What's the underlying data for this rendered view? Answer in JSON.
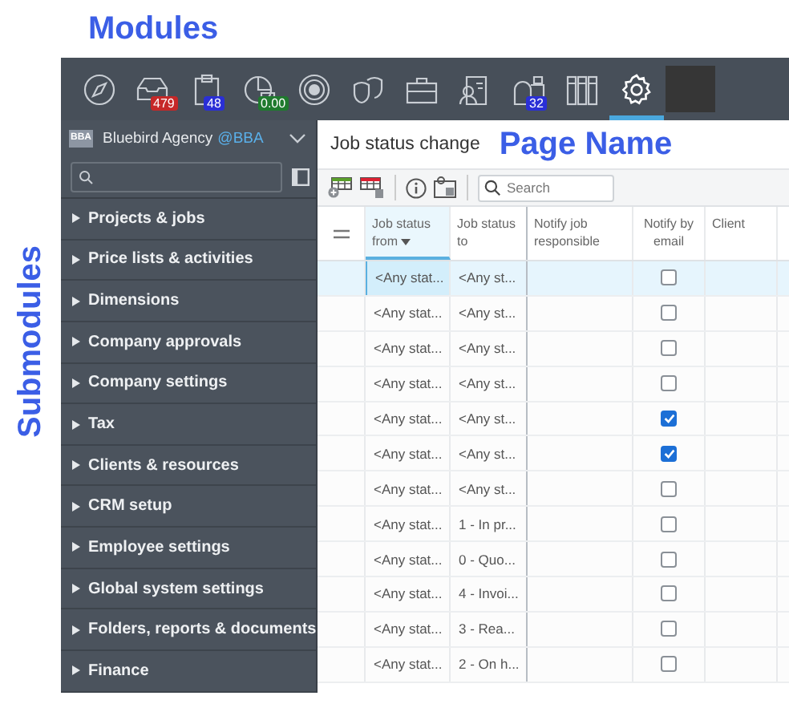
{
  "annotations": {
    "modules": "Modules",
    "page_name": "Page Name",
    "submodules": "Submodules"
  },
  "modules": [
    {
      "selected": false
    },
    {
      "selected": false,
      "badge": {
        "text": "479",
        "color": "#c62828"
      }
    },
    {
      "selected": false,
      "badge": {
        "text": "48",
        "color": "#2a2fd6"
      }
    },
    {
      "selected": false,
      "badge": {
        "text": "0.00",
        "color": "#1f7a2e"
      }
    },
    {
      "selected": false
    },
    {
      "selected": false
    },
    {
      "selected": false
    },
    {
      "selected": false
    },
    {
      "selected": false,
      "badge": {
        "text": "32",
        "color": "#2a2fd6"
      }
    },
    {
      "selected": false
    },
    {
      "selected": true
    }
  ],
  "sidebar": {
    "org_badge": "BBA",
    "org_name": "Bluebird Agency",
    "org_handle": "@BBA",
    "items": [
      {
        "label": "Projects & jobs",
        "expanded": false
      },
      {
        "label": "Price lists & activities",
        "expanded": false
      },
      {
        "label": "Dimensions",
        "expanded": false
      },
      {
        "label": "Company approvals",
        "expanded": false
      },
      {
        "label": "Company settings",
        "expanded": false
      },
      {
        "label": "Tax",
        "expanded": false
      },
      {
        "label": "Clients & resources",
        "expanded": false
      },
      {
        "label": "CRM setup",
        "expanded": false
      },
      {
        "label": "Employee settings",
        "expanded": false
      },
      {
        "label": "Global system settings",
        "expanded": false
      },
      {
        "label": "Folders, reports & documents",
        "expanded": false
      },
      {
        "label": "Finance",
        "expanded": false
      }
    ]
  },
  "page": {
    "title": "Job status change",
    "search": {
      "placeholder": "Search"
    }
  },
  "table": {
    "columns": [
      {
        "label": "Job status from",
        "sorted": true
      },
      {
        "label": "Job status to",
        "sorted": false
      },
      {
        "label": "Notify job responsible",
        "sorted": false
      },
      {
        "label": "Notify by email",
        "sorted": false
      },
      {
        "label": "Client",
        "sorted": false
      }
    ],
    "rows": [
      {
        "from": "<Any stat...",
        "to": "<Any st...",
        "notify_by_email": false,
        "selected": true
      },
      {
        "from": "<Any stat...",
        "to": "<Any st...",
        "notify_by_email": false,
        "selected": false
      },
      {
        "from": "<Any stat...",
        "to": "<Any st...",
        "notify_by_email": false,
        "selected": false
      },
      {
        "from": "<Any stat...",
        "to": "<Any st...",
        "notify_by_email": false,
        "selected": false
      },
      {
        "from": "<Any stat...",
        "to": "<Any st...",
        "notify_by_email": true,
        "selected": false
      },
      {
        "from": "<Any stat...",
        "to": "<Any st...",
        "notify_by_email": true,
        "selected": false
      },
      {
        "from": "<Any stat...",
        "to": "<Any st...",
        "notify_by_email": false,
        "selected": false
      },
      {
        "from": "<Any stat...",
        "to": "1 - In pr...",
        "notify_by_email": false,
        "selected": false
      },
      {
        "from": "<Any stat...",
        "to": "0 - Quo...",
        "notify_by_email": false,
        "selected": false
      },
      {
        "from": "<Any stat...",
        "to": "4 - Invoi...",
        "notify_by_email": false,
        "selected": false
      },
      {
        "from": "<Any stat...",
        "to": "3 - Rea...",
        "notify_by_email": false,
        "selected": false
      },
      {
        "from": "<Any stat...",
        "to": "2 - On h...",
        "notify_by_email": false,
        "selected": false
      }
    ]
  }
}
